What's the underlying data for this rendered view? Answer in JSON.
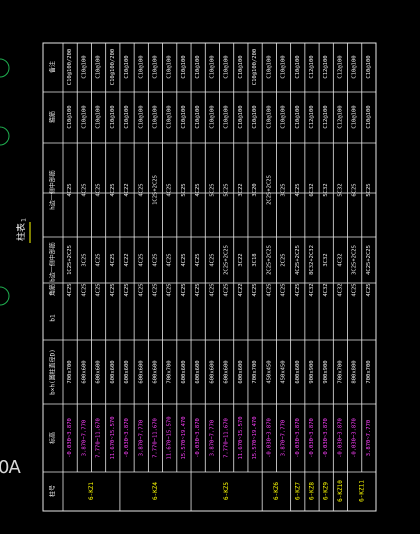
{
  "title": "柱表",
  "title_marker": "1",
  "left_marker": "0A",
  "colors": {
    "background": "#000000",
    "grid": "#e8e8e8",
    "text": "#f0f0f0",
    "column_id": "#ffff00",
    "elevation": "#ff40ff",
    "title_underline": "#ffff00",
    "margin_circles": "#1fae4f"
  },
  "headers": [
    "柱号",
    "标高",
    "b×h(圆柱直径D)",
    "b1",
    "b2",
    "h1",
    "h2",
    "全部纵筋",
    "角筋",
    "b边一侧中部筋",
    "h边一侧中部筋",
    "箍筋类型号",
    "箍筋",
    "备注"
  ],
  "visible_headers": [
    "柱号",
    "标高",
    "b×h(圆柱直径D)",
    "b1",
    "角筋",
    "b边一侧中部筋",
    "h边一侧中部筋",
    "箍筋",
    "备注"
  ],
  "groups": [
    {
      "column_id": "KZ1",
      "label": "6-KZ1",
      "rows": [
        {
          "elev": "-0.030~3.870",
          "size": "700x700",
          "corner": "4C25",
          "b_mid": "1C25+2C25",
          "h_mid": "4C25",
          "stirrup": "C10@100",
          "type": "C10@100/200"
        },
        {
          "elev": "3.870~7.770",
          "size": "600x600",
          "corner": "4C25",
          "b_mid": "3C25",
          "h_mid": "4C25",
          "stirrup": "C10@100",
          "type": "C10@100"
        },
        {
          "elev": "7.770~11.670",
          "size": "600x600",
          "corner": "4C25",
          "b_mid": "4C25",
          "h_mid": "4C25",
          "stirrup": "C10@100",
          "type": "C10@100"
        },
        {
          "elev": "11.670~15.570",
          "size": "600x600",
          "corner": "4C25",
          "b_mid": "4C25",
          "h_mid": "4C25",
          "stirrup": "C10@100",
          "type": "C10@100/200"
        }
      ]
    },
    {
      "column_id": "KZ4",
      "label": "6-KZ4",
      "rows": [
        {
          "elev": "-0.030~3.870",
          "size": "600x600",
          "corner": "4C25",
          "b_mid": "4C22",
          "h_mid": "4C22",
          "stirrup": "C10@100",
          "type": "C10@100"
        },
        {
          "elev": "3.870~7.770",
          "size": "600x600",
          "corner": "4C25",
          "b_mid": "4C25",
          "h_mid": "4C25",
          "stirrup": "C10@100",
          "type": "C10@100"
        },
        {
          "elev": "7.770~11.670",
          "size": "600x600",
          "corner": "4C25",
          "b_mid": "4C25",
          "h_mid": "1C25+2C25",
          "stirrup": "C10@100",
          "type": "C10@100"
        },
        {
          "elev": "11.670~15.570",
          "size": "700x700",
          "corner": "4C25",
          "b_mid": "4C25",
          "h_mid": "4C25",
          "stirrup": "C10@100",
          "type": "C10@100"
        },
        {
          "elev": "15.570~19.470",
          "size": "600x600",
          "corner": "4C25",
          "b_mid": "4C25",
          "h_mid": "5C25",
          "stirrup": "C10@100",
          "type": "C10@100"
        }
      ]
    },
    {
      "column_id": "KZ5",
      "label": "6-KZ5",
      "rows": [
        {
          "elev": "-0.030~3.870",
          "size": "600x600",
          "corner": "4C25",
          "b_mid": "4C25",
          "h_mid": "4C25",
          "stirrup": "C10@100",
          "type": "C10@100"
        },
        {
          "elev": "3.870~7.770",
          "size": "600x600",
          "corner": "4C25",
          "b_mid": "4C25",
          "h_mid": "5C25",
          "stirrup": "C10@100",
          "type": "C10@100"
        },
        {
          "elev": "7.770~11.670",
          "size": "600x600",
          "corner": "4C25",
          "b_mid": "2C25+2C25",
          "h_mid": "5C25",
          "stirrup": "C10@100",
          "type": "C10@100"
        },
        {
          "elev": "11.670~15.570",
          "size": "600x600",
          "corner": "4C22",
          "b_mid": "3C22",
          "h_mid": "3C22",
          "stirrup": "C10@100",
          "type": "C10@100"
        },
        {
          "elev": "15.570~19.470",
          "size": "700x700",
          "corner": "4C25",
          "b_mid": "3C18",
          "h_mid": "3C20",
          "stirrup": "C10@100",
          "type": "C10@100/200"
        }
      ]
    },
    {
      "column_id": "KZ6",
      "label": "6-KZ6",
      "rows": [
        {
          "elev": "-0.030~3.870",
          "size": "450x450",
          "corner": "4C25",
          "b_mid": "2C25+2C25",
          "h_mid": "2C25+2C25",
          "stirrup": "C10@100",
          "type": "C10@100"
        },
        {
          "elev": "3.870~7.770",
          "size": "450x450",
          "corner": "4C25",
          "b_mid": "2C25",
          "h_mid": "3C25",
          "stirrup": "C10@100",
          "type": "C10@100"
        }
      ]
    },
    {
      "column_id": "KZ7",
      "label": "6-KZ7",
      "rows": [
        {
          "elev": "-0.030~3.870",
          "size": "600x600",
          "corner": "4C25",
          "b_mid": "4C25+2C25",
          "h_mid": "4C25",
          "stirrup": "C10@100",
          "type": "C10@100"
        }
      ]
    },
    {
      "column_id": "KZ8",
      "label": "6-KZ8",
      "rows": [
        {
          "elev": "-0.030~3.870",
          "size": "900x900",
          "corner": "4C32",
          "b_mid": "8C32+2C32",
          "h_mid": "6C32",
          "stirrup": "C12@100",
          "type": "C12@100"
        }
      ]
    },
    {
      "column_id": "KZ9",
      "label": "6-KZ9",
      "rows": [
        {
          "elev": "-0.030~3.870",
          "size": "900x900",
          "corner": "4C32",
          "b_mid": "3C32",
          "h_mid": "5C32",
          "stirrup": "C12@100",
          "type": "C12@100"
        }
      ]
    },
    {
      "column_id": "KZ10",
      "label": "6-KZ10",
      "rows": [
        {
          "elev": "-0.030~3.870",
          "size": "700x700",
          "corner": "4C32",
          "b_mid": "4C32",
          "h_mid": "5C32",
          "stirrup": "C12@100",
          "type": "C12@100"
        }
      ]
    },
    {
      "column_id": "KZ11",
      "label": "6-KZ11",
      "rows": [
        {
          "elev": "-0.030~3.870",
          "size": "800x800",
          "corner": "4C25",
          "b_mid": "3C25+2C25",
          "h_mid": "6C25",
          "stirrup": "C10@100",
          "type": "C10@100"
        },
        {
          "elev": "3.870~7.770",
          "size": "700x700",
          "corner": "4C25",
          "b_mid": "4C25+2C25",
          "h_mid": "5C25",
          "stirrup": "C10@100",
          "type": "C10@100"
        }
      ]
    }
  ]
}
